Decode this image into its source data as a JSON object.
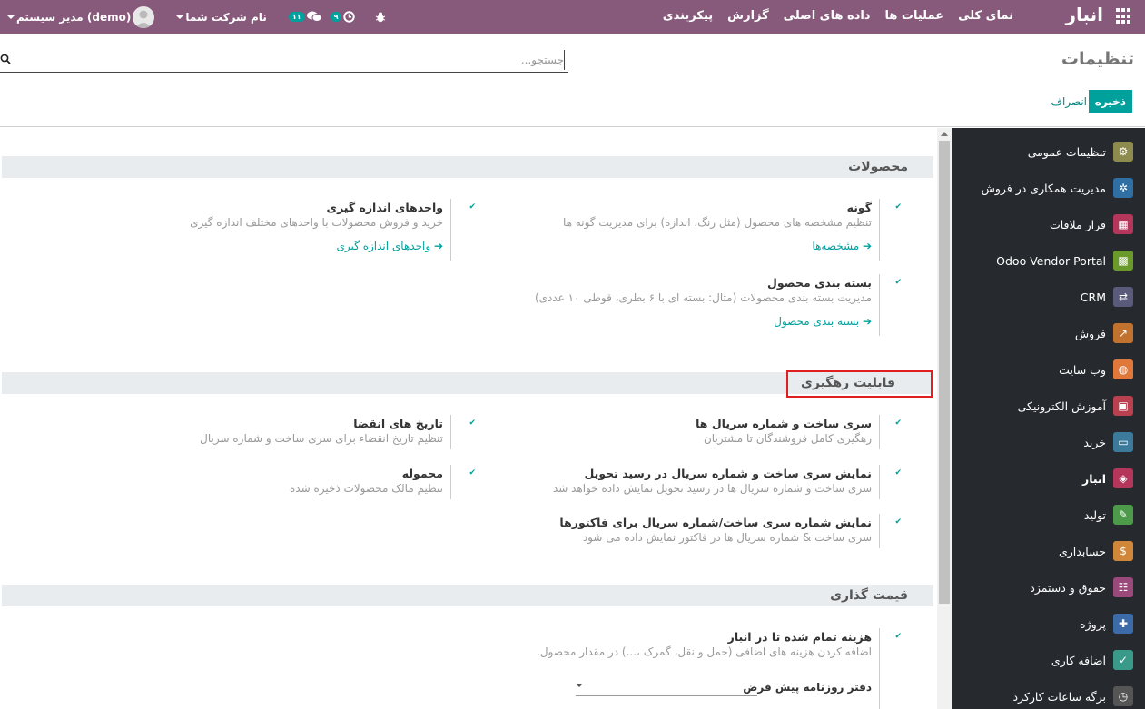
{
  "navbar": {
    "brand": "انبار",
    "menu": [
      "نمای کلی",
      "عملیات ها",
      "داده های اصلی",
      "گزارش",
      "پیکربندی"
    ],
    "company": "نام شرکت شما",
    "user": "مدیر سیستم (demo)",
    "activity_count": "۹",
    "message_count": "۱۱"
  },
  "control_panel": {
    "title": "تنظیمات",
    "search_placeholder": "جستجو...",
    "save_label": "ذخیره",
    "discard_label": "انصراف"
  },
  "sidebar": {
    "items": [
      {
        "label": "تنظیمات عمومی",
        "icon": "gear-icon",
        "color": "#8d8b4d"
      },
      {
        "label": "مدیریت همکاری در فروش",
        "icon": "network-icon",
        "color": "#2f6fa4"
      },
      {
        "label": "قرار ملاقات",
        "icon": "calendar-icon",
        "color": "#b5365b"
      },
      {
        "label": "Odoo Vendor Portal",
        "icon": "grid-icon",
        "color": "#6a9a2c"
      },
      {
        "label": "CRM",
        "icon": "handshake-icon",
        "color": "#5a5a7a"
      },
      {
        "label": "فروش",
        "icon": "chart-icon",
        "color": "#c1722f"
      },
      {
        "label": "وب سایت",
        "icon": "globe-icon",
        "color": "#e0783b"
      },
      {
        "label": "آموزش الکترونیکی",
        "icon": "presentation-icon",
        "color": "#b8404f"
      },
      {
        "label": "خرید",
        "icon": "credit-card-icon",
        "color": "#3c7a9c"
      },
      {
        "label": "انبار",
        "icon": "boxes-icon",
        "color": "#b5365b",
        "active": true
      },
      {
        "label": "تولید",
        "icon": "wrench-icon",
        "color": "#4c9a4a"
      },
      {
        "label": "حسابداری",
        "icon": "invoice-icon",
        "color": "#d0873a"
      },
      {
        "label": "حقوق و دستمزد",
        "icon": "id-card-icon",
        "color": "#9a4a7a"
      },
      {
        "label": "پروژه",
        "icon": "puzzle-icon",
        "color": "#3d6aa8"
      },
      {
        "label": "اضافه کاری",
        "icon": "calendar-check-icon",
        "color": "#3a9a8a"
      },
      {
        "label": "برگه ساعات کارکرد",
        "icon": "stopwatch-icon",
        "color": "#555555"
      }
    ]
  },
  "sections": {
    "products": "محصولات",
    "traceability": "قابلیت رهگیری",
    "valuation": "قیمت گذاری"
  },
  "settings": {
    "variants": {
      "title": "گونه",
      "desc": "تنظیم مشخصه های محصول (مثل رنگ، اندازه) برای مدیریت گونه ها",
      "link": "مشخصه‌ها"
    },
    "uom": {
      "title": "واحدهای اندازه گیری",
      "desc": "خرید و فروش محصولات با واحدهای مختلف اندازه گیری",
      "link": "واحدهای اندازه گیری"
    },
    "packaging": {
      "title": "بسته بندی محصول",
      "desc": "مدیریت بسته بندی محصولات (مثال: بسته ای با ۶ بطری، قوطی ۱۰ عددی)",
      "link": "بسته بندی محصول"
    },
    "lots": {
      "title": "سری ساخت و شماره سریال ها",
      "desc": "رهگیری کامل فروشندگان تا مشتریان"
    },
    "expiry": {
      "title": "تاریخ های انقضا",
      "desc": "تنظیم تاریخ انقضاء برای سری ساخت و شماره سریال"
    },
    "lots_on_receipt": {
      "title": "نمایش سری ساخت و شماره سریال در رسید تحویل",
      "desc": "سری ساخت و شماره سریال ها در رسید تحویل نمایش داده خواهد شد"
    },
    "consignment": {
      "title": "محموله",
      "desc": "تنظیم مالک محصولات ذخیره شده"
    },
    "lots_on_invoice": {
      "title": "نمایش شماره سری ساخت/شماره سریال برای فاکتورها",
      "desc": "سری ساخت & شماره سریال ها در فاکتور نمایش داده می شود"
    },
    "landed_costs": {
      "title": "هزینه تمام شده تا در انبار",
      "desc": "اضافه کردن هزینه های اضافی (حمل و نقل، گمرک ،...) در مقدار محصول."
    },
    "default_journal": {
      "label": "دفتر روزنامه پیش فرض"
    }
  }
}
